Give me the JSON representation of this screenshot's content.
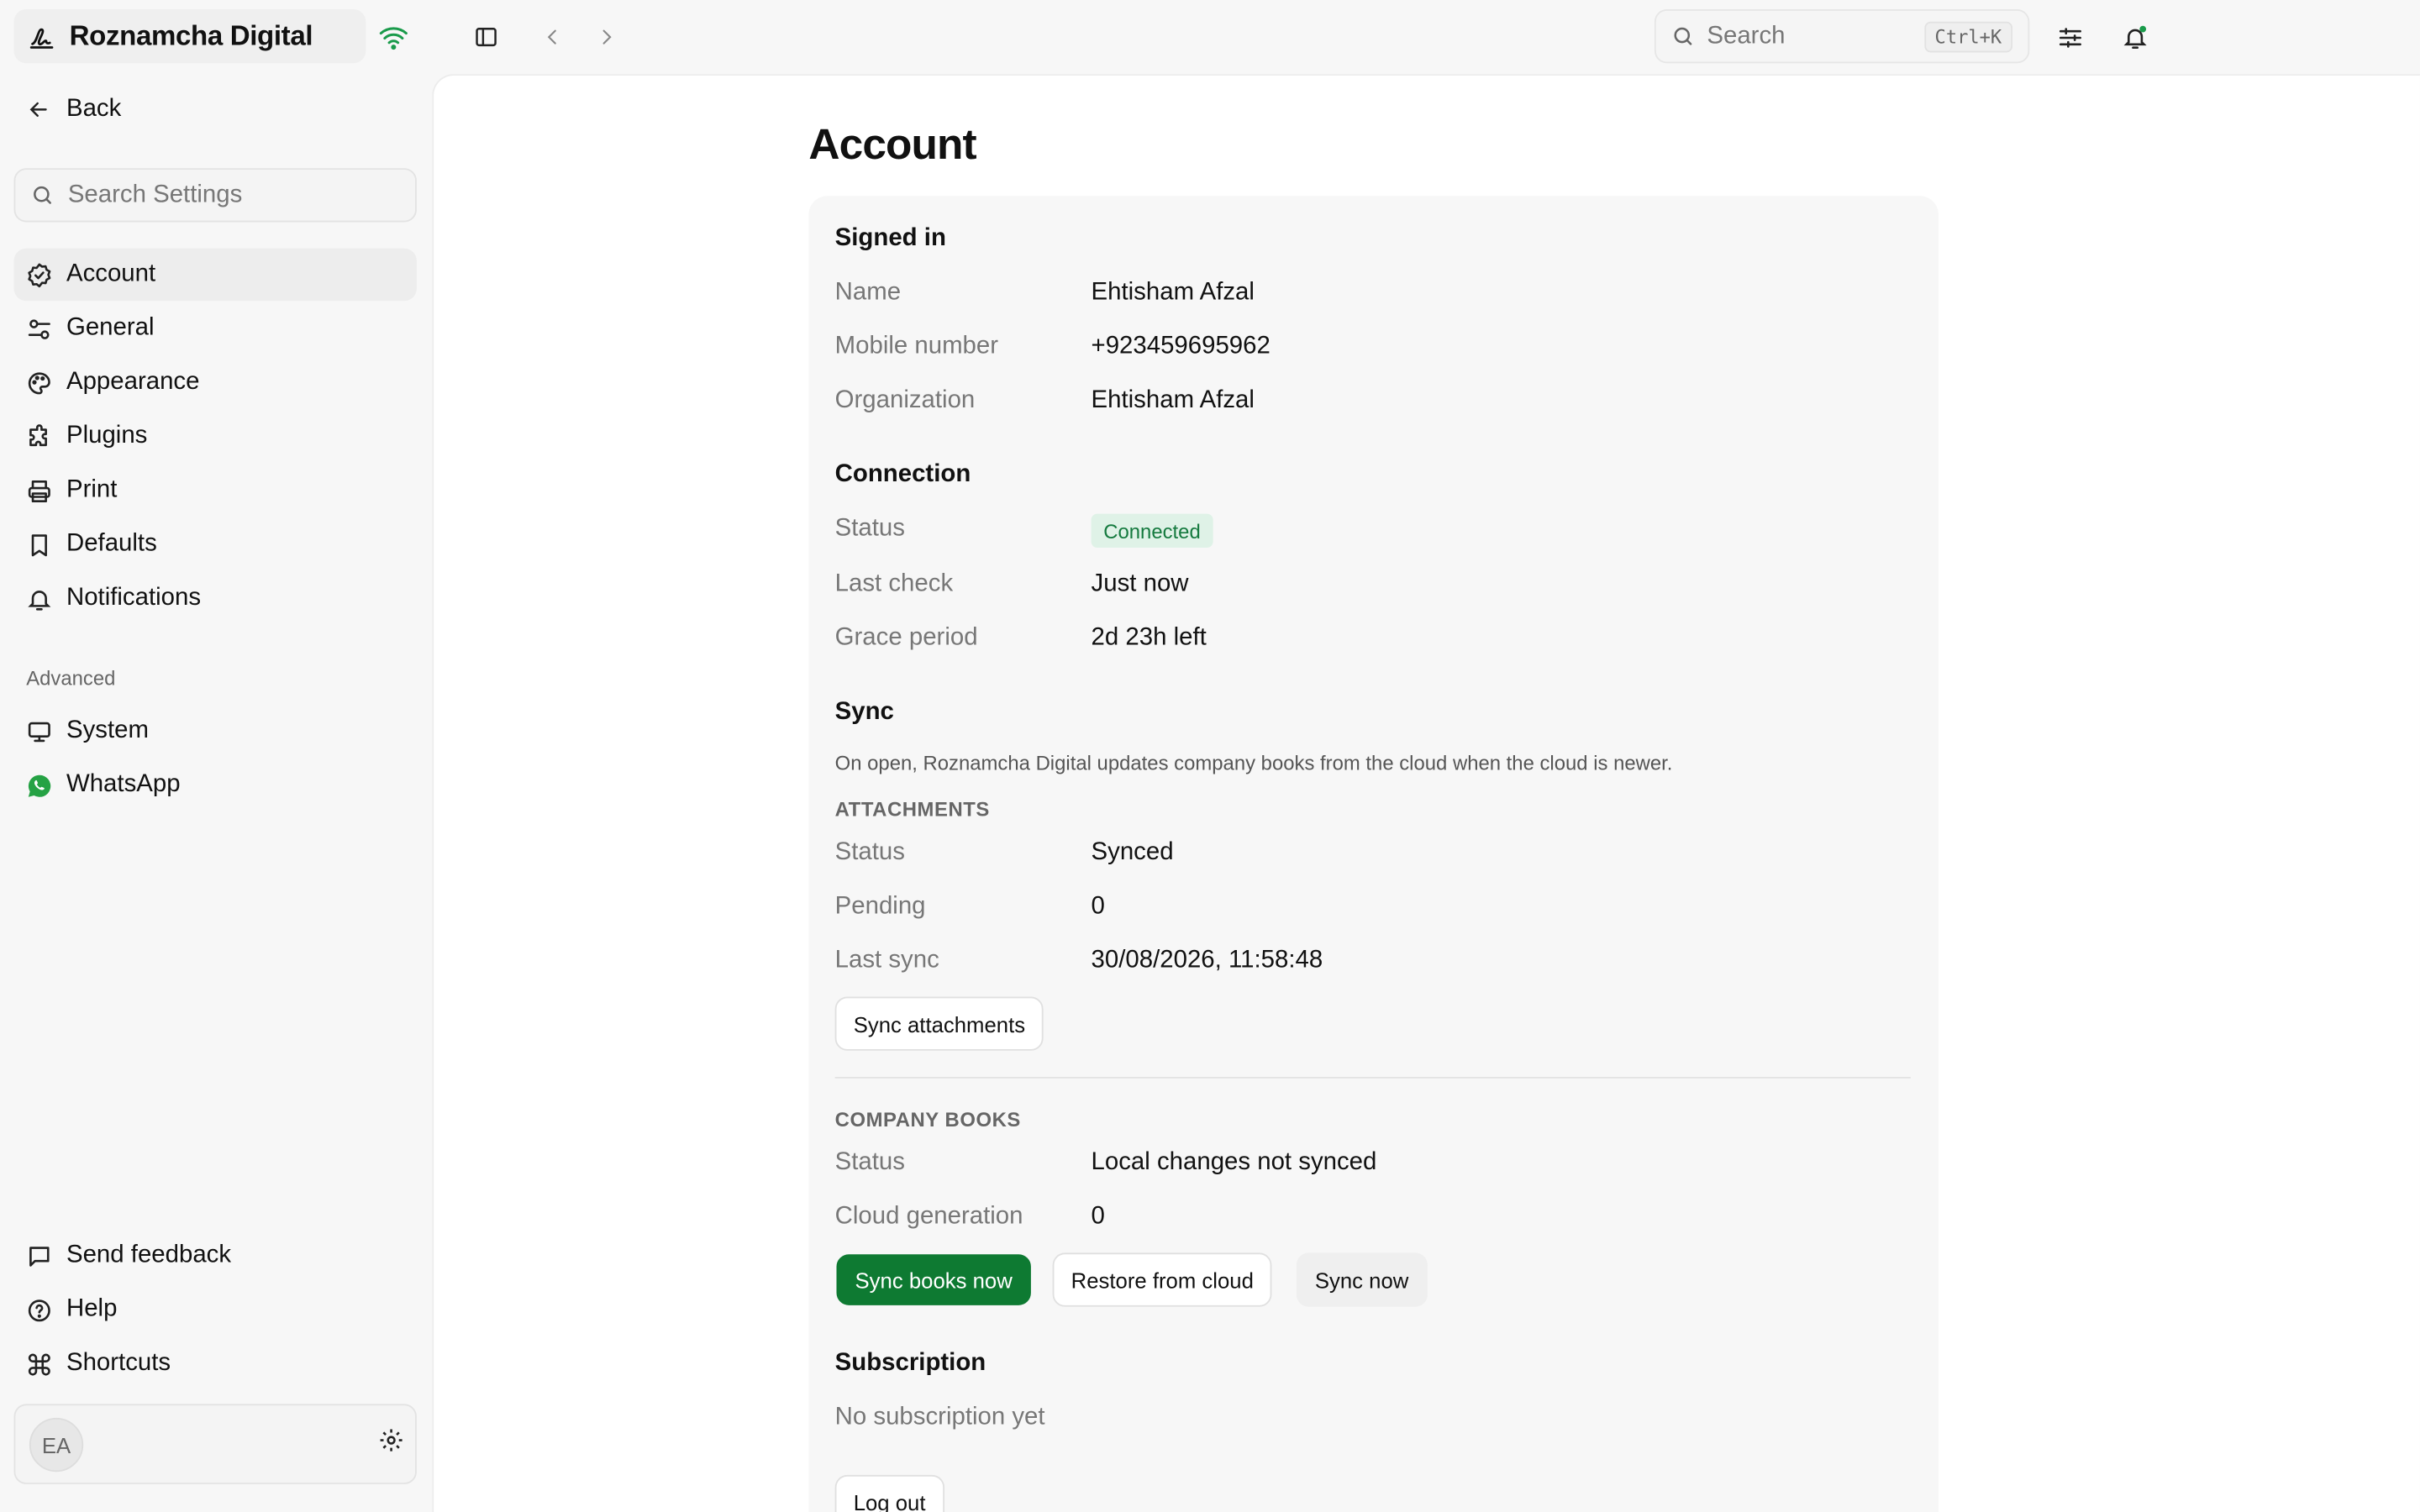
{
  "app": {
    "title": "Roznamcha Digital",
    "accent_color": "#0e7a32",
    "online_indicator": "wifi-icon"
  },
  "topbar": {
    "search_placeholder": "Search",
    "search_shortcut": "Ctrl+K",
    "icons": [
      "sidebar-toggle-icon",
      "chevron-left-icon",
      "chevron-right-icon",
      "sliders-icon",
      "bell-icon"
    ]
  },
  "sidebar": {
    "back_label": "Back",
    "search_placeholder": "Search Settings",
    "items": [
      {
        "label": "Account",
        "icon": "badge-check-icon",
        "active": true
      },
      {
        "label": "General",
        "icon": "toggles-icon"
      },
      {
        "label": "Appearance",
        "icon": "palette-icon"
      },
      {
        "label": "Plugins",
        "icon": "puzzle-icon"
      },
      {
        "label": "Print",
        "icon": "printer-icon"
      },
      {
        "label": "Defaults",
        "icon": "bookmark-icon"
      },
      {
        "label": "Notifications",
        "icon": "bell-icon"
      }
    ],
    "advanced_label": "Advanced",
    "advanced_items": [
      {
        "label": "System",
        "icon": "monitor-icon"
      },
      {
        "label": "WhatsApp",
        "icon": "whatsapp-icon"
      }
    ],
    "footer_items": [
      {
        "label": "Send feedback",
        "icon": "message-square-icon"
      },
      {
        "label": "Help",
        "icon": "help-circle-icon"
      },
      {
        "label": "Shortcuts",
        "icon": "command-icon"
      }
    ],
    "user_initials": "EA"
  },
  "main": {
    "title": "Account",
    "signed_in": {
      "heading": "Signed in",
      "rows": [
        {
          "label": "Name",
          "value": "Ehtisham Afzal"
        },
        {
          "label": "Mobile number",
          "value": "+923459695962"
        },
        {
          "label": "Organization",
          "value": "Ehtisham Afzal"
        }
      ]
    },
    "connection": {
      "heading": "Connection",
      "status_label": "Status",
      "status_value": "Connected",
      "rows": [
        {
          "label": "Last check",
          "value": "Just now"
        },
        {
          "label": "Grace period",
          "value": "2d 23h left"
        }
      ]
    },
    "sync": {
      "heading": "Sync",
      "note": "On open, Roznamcha Digital updates company books from the cloud when the cloud is newer.",
      "attachments": {
        "heading": "ATTACHMENTS",
        "rows": [
          {
            "label": "Status",
            "value": "Synced"
          },
          {
            "label": "Pending",
            "value": "0"
          },
          {
            "label": "Last sync",
            "value": "30/08/2026, 11:58:48"
          }
        ],
        "button": "Sync attachments"
      },
      "company_books": {
        "heading": "COMPANY BOOKS",
        "rows": [
          {
            "label": "Status",
            "value": "Local changes not synced"
          },
          {
            "label": "Cloud generation",
            "value": "0"
          }
        ],
        "buttons": {
          "sync_books": "Sync books now",
          "restore": "Restore from cloud",
          "sync_now": "Sync now"
        }
      }
    },
    "subscription": {
      "heading": "Subscription",
      "text": "No subscription yet"
    },
    "logout_label": "Log out"
  }
}
